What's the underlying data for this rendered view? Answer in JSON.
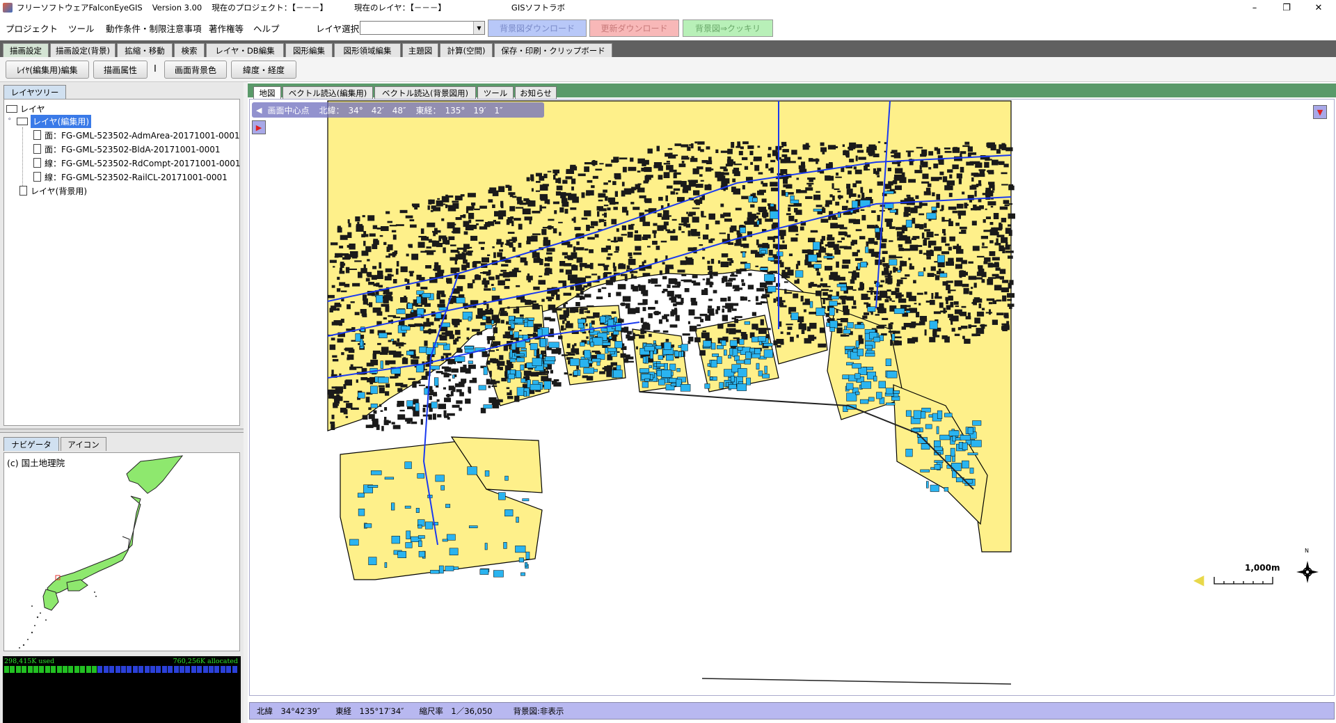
{
  "titlebar": {
    "app_title": "フリーソフトウェアFalconEyeGIS",
    "version": "Version 3.00",
    "project": "現在のプロジェクト：【－－－】",
    "layer": "現在のレイヤ：【－－－】",
    "org": "GISソフトラボ"
  },
  "menu": {
    "project": "プロジェクト",
    "tools": "ツール",
    "conditions": "動作条件・制限注意事項",
    "copyright": "著作権等",
    "help": "ヘルプ",
    "layer_select_label": "レイヤ選択",
    "layer_select_value": "",
    "bg_download": "背景図ダウンロード",
    "update_download": "更新ダウンロード",
    "bg_clear": "背景図⇒クッキリ"
  },
  "ribbon_tabs": [
    "描画設定",
    "描画設定(背景)",
    "拡縮・移動",
    "検索",
    "レイヤ・DB編集",
    "図形編集",
    "図形領域編集",
    "主題図",
    "計算(空間)",
    "保存・印刷・クリップボード"
  ],
  "ribbon_buttons": {
    "layer_edit": "ﾚｲﾔ(編集用)編集",
    "draw_attr": "描画属性",
    "separator": "I",
    "bg_color": "画面背景色",
    "latlon": "緯度・経度"
  },
  "left_tabs": {
    "layer_tree": "レイヤツリー",
    "navigator": "ナビゲータ",
    "icon": "アイコン"
  },
  "tree": {
    "root": "レイヤ",
    "edit_layer": "レイヤ(編集用)",
    "items": [
      "面：FG-GML-523502-AdmArea-20171001-0001",
      "面：FG-GML-523502-BldA-20171001-0001",
      "線：FG-GML-523502-RdCompt-20171001-0001",
      "線：FG-GML-523502-RailCL-20171001-0001"
    ],
    "bg_layer": "レイヤ(背景用)"
  },
  "navigator": {
    "credit": "(c) 国土地理院"
  },
  "memory": {
    "used": "298,415K used",
    "allocated": "760,256K allocated",
    "used_fraction": 0.39
  },
  "map_tabs": [
    "地図",
    "ベクトル読込(編集用)",
    "ベクトル読込(背景図用)",
    "ツール",
    "お知らせ"
  ],
  "map": {
    "center_label": "画面中心点",
    "center_lat": "北緯：　34°　42′　48″",
    "center_lon": "東経：　135°　19′　1″",
    "scale_label": "1,000m",
    "north": "N",
    "colors": {
      "land": "#fef08a",
      "building": "#2ab4f0",
      "road": "#1a1a1a",
      "rail": "#1a3af0"
    }
  },
  "status": {
    "lat": "北緯　34°42′39″",
    "lon": "東経　135°17′34″",
    "scale": "縮尺率　1／36,050",
    "bg": "背景図:非表示"
  }
}
